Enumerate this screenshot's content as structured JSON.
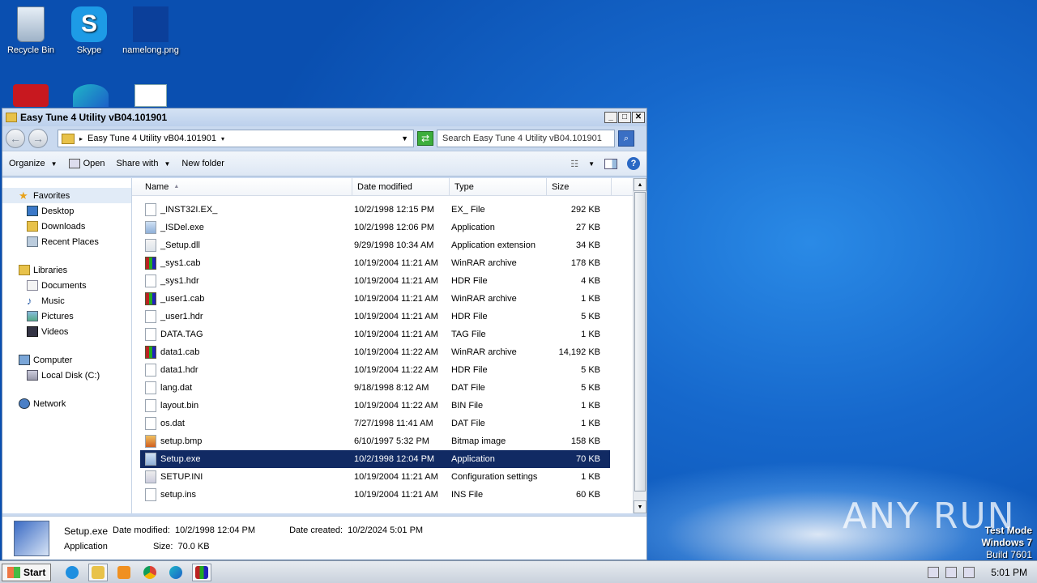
{
  "desktop": {
    "icons": [
      {
        "label": "Recycle Bin"
      },
      {
        "label": "Skype"
      },
      {
        "label": "namelong.png"
      }
    ],
    "watermark": "ANY RUN",
    "testmode": {
      "line1": "Test Mode",
      "line2": "Windows 7",
      "line3": "Build 7601"
    }
  },
  "window": {
    "title": "Easy Tune 4 Utility vB04.101901",
    "address": "Easy Tune 4 Utility vB04.101901",
    "search_placeholder": "Search Easy Tune 4 Utility vB04.101901",
    "toolbar": {
      "organize": "Organize",
      "open": "Open",
      "share_with": "Share with",
      "new_folder": "New folder"
    },
    "nav": {
      "favorites": "Favorites",
      "desktop": "Desktop",
      "downloads": "Downloads",
      "recent_places": "Recent Places",
      "libraries": "Libraries",
      "documents": "Documents",
      "music": "Music",
      "pictures": "Pictures",
      "videos": "Videos",
      "computer": "Computer",
      "local_disk": "Local Disk (C:)",
      "network": "Network"
    },
    "columns": {
      "name": "Name",
      "date": "Date modified",
      "type": "Type",
      "size": "Size"
    },
    "files": [
      {
        "name": "_INST32I.EX_",
        "date": "10/2/1998 12:15 PM",
        "type": "EX_ File",
        "size": "292 KB",
        "icon": "file"
      },
      {
        "name": "_ISDel.exe",
        "date": "10/2/1998 12:06 PM",
        "type": "Application",
        "size": "27 KB",
        "icon": "exe"
      },
      {
        "name": "_Setup.dll",
        "date": "9/29/1998 10:34 AM",
        "type": "Application extension",
        "size": "34 KB",
        "icon": "dll"
      },
      {
        "name": "_sys1.cab",
        "date": "10/19/2004 11:21 AM",
        "type": "WinRAR archive",
        "size": "178 KB",
        "icon": "cab"
      },
      {
        "name": "_sys1.hdr",
        "date": "10/19/2004 11:21 AM",
        "type": "HDR File",
        "size": "4 KB",
        "icon": "file"
      },
      {
        "name": "_user1.cab",
        "date": "10/19/2004 11:21 AM",
        "type": "WinRAR archive",
        "size": "1 KB",
        "icon": "cab"
      },
      {
        "name": "_user1.hdr",
        "date": "10/19/2004 11:21 AM",
        "type": "HDR File",
        "size": "5 KB",
        "icon": "file"
      },
      {
        "name": "DATA.TAG",
        "date": "10/19/2004 11:21 AM",
        "type": "TAG File",
        "size": "1 KB",
        "icon": "file"
      },
      {
        "name": "data1.cab",
        "date": "10/19/2004 11:22 AM",
        "type": "WinRAR archive",
        "size": "14,192 KB",
        "icon": "cab"
      },
      {
        "name": "data1.hdr",
        "date": "10/19/2004 11:22 AM",
        "type": "HDR File",
        "size": "5 KB",
        "icon": "file"
      },
      {
        "name": "lang.dat",
        "date": "9/18/1998 8:12 AM",
        "type": "DAT File",
        "size": "5 KB",
        "icon": "file"
      },
      {
        "name": "layout.bin",
        "date": "10/19/2004 11:22 AM",
        "type": "BIN File",
        "size": "1 KB",
        "icon": "file"
      },
      {
        "name": "os.dat",
        "date": "7/27/1998 11:41 AM",
        "type": "DAT File",
        "size": "1 KB",
        "icon": "file"
      },
      {
        "name": "setup.bmp",
        "date": "6/10/1997 5:32 PM",
        "type": "Bitmap image",
        "size": "158 KB",
        "icon": "bmp"
      },
      {
        "name": "Setup.exe",
        "date": "10/2/1998 12:04 PM",
        "type": "Application",
        "size": "70 KB",
        "icon": "exe",
        "selected": true
      },
      {
        "name": "SETUP.INI",
        "date": "10/19/2004 11:21 AM",
        "type": "Configuration settings",
        "size": "1 KB",
        "icon": "ini"
      },
      {
        "name": "setup.ins",
        "date": "10/19/2004 11:21 AM",
        "type": "INS File",
        "size": "60 KB",
        "icon": "file"
      }
    ],
    "details": {
      "name": "Setup.exe",
      "modified_label": "Date modified:",
      "modified": "10/2/1998 12:04 PM",
      "created_label": "Date created:",
      "created": "10/2/2024 5:01 PM",
      "type": "Application",
      "size_label": "Size:",
      "size": "70.0 KB"
    }
  },
  "taskbar": {
    "start": "Start",
    "clock": "5:01 PM"
  }
}
